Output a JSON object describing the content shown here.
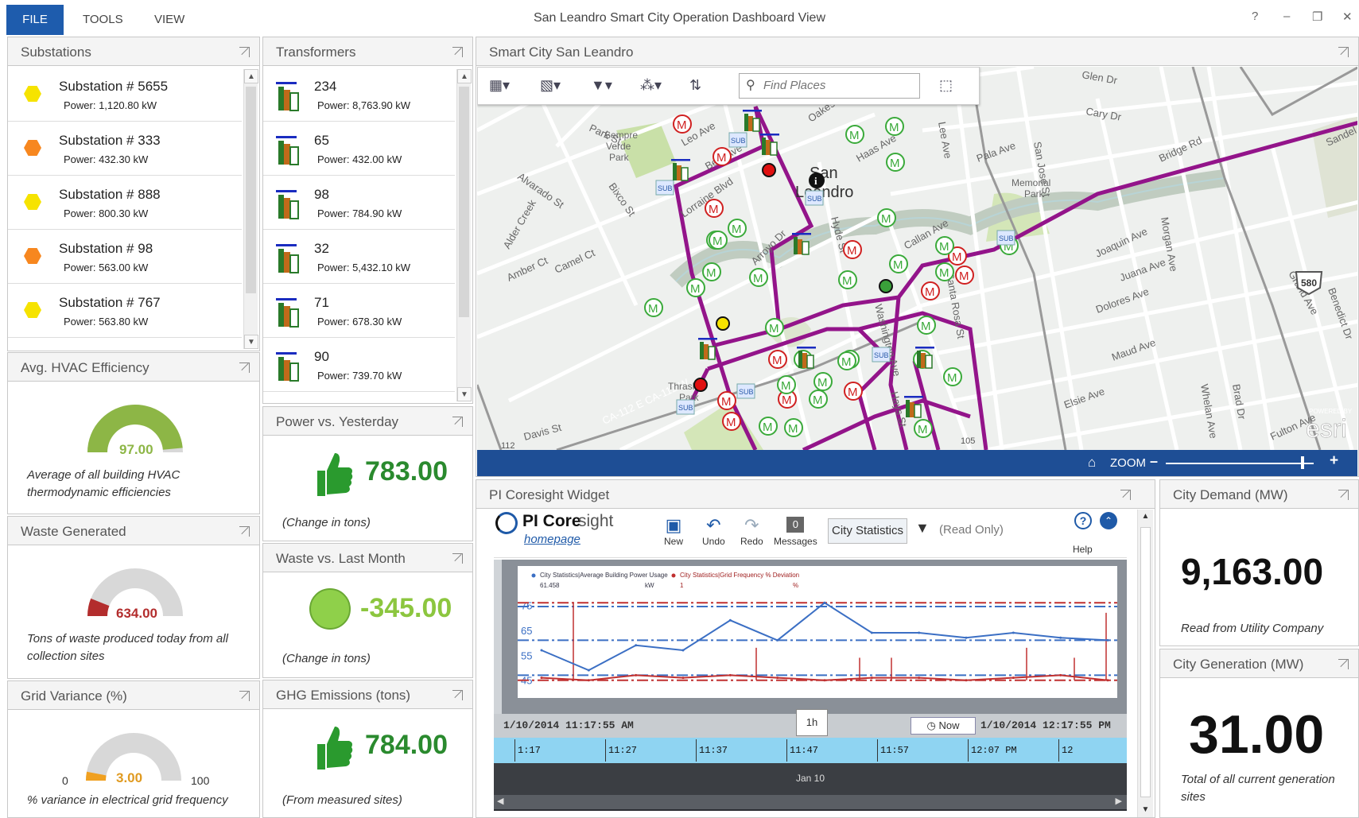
{
  "menu": {
    "file": "FILE",
    "tools": "TOOLS",
    "view": "VIEW"
  },
  "window": {
    "title": "San Leandro Smart City Operation Dashboard View",
    "help": "?",
    "minimize": "–",
    "restore": "❐",
    "close": "✕"
  },
  "substations": {
    "title": "Substations",
    "items": [
      {
        "name": "Substation # 5655",
        "power": "Power: 1,120.80 kW",
        "color": "#f6e300"
      },
      {
        "name": "Substation # 333",
        "power": "Power: 432.30 kW",
        "color": "#f7871f"
      },
      {
        "name": "Substation # 888",
        "power": "Power: 800.30 kW",
        "color": "#f6e300"
      },
      {
        "name": "Substation # 98",
        "power": "Power: 563.00 kW",
        "color": "#f7871f"
      },
      {
        "name": "Substation # 767",
        "power": "Power: 563.80 kW",
        "color": "#f6e300"
      }
    ]
  },
  "transformers": {
    "title": "Transformers",
    "items": [
      {
        "name": "234",
        "power": "Power: 8,763.90 kW"
      },
      {
        "name": "65",
        "power": "Power: 432.00 kW"
      },
      {
        "name": "98",
        "power": "Power: 784.90 kW"
      },
      {
        "name": "32",
        "power": "Power: 5,432.10 kW"
      },
      {
        "name": "71",
        "power": "Power: 678.30 kW"
      },
      {
        "name": "90",
        "power": "Power: 739.70 kW"
      }
    ]
  },
  "hvac": {
    "title": "Avg. HVAC Efficiency",
    "value": "97.00",
    "fraction": 0.97,
    "caption1": "Average of all building HVAC",
    "caption2": "thermodynamic efficiencies",
    "color": "#8db646"
  },
  "waste": {
    "title": "Waste Generated",
    "value": "634.00",
    "fraction": 0.12,
    "caption1": "Tons of waste produced today from all",
    "caption2": "collection sites",
    "color": "#b32d2d"
  },
  "grid": {
    "title": "Grid Variance (%)",
    "value": "3.00",
    "fraction": 0.03,
    "min": "0",
    "max": "100",
    "caption": "% variance in electrical grid frequency",
    "color": "#f0a020"
  },
  "power": {
    "title": "Power vs. Yesterday",
    "value": "783.00",
    "caption": "(Change in tons)"
  },
  "wasteMonth": {
    "title": "Waste vs. Last Month",
    "value": "-345.00",
    "caption": "(Change in tons)"
  },
  "ghg": {
    "title": "GHG Emissions (tons)",
    "value": "784.00",
    "caption": "(From measured sites)"
  },
  "map": {
    "title": "Smart City San Leandro",
    "find_placeholder": "Find Places",
    "zoom_label": "ZOOM",
    "labels": {
      "parkst": "Park St",
      "sempre": "Sempre",
      "verde": "Verde",
      "parkA": "Park",
      "leo": "Leo Ave",
      "best": "Best Ave",
      "oakes": "Oakes Blvd",
      "san": "San",
      "leandro": "Leandro",
      "alvarado": "Alvarado St",
      "bixco": "Bixco St",
      "alder": "Alder Creek",
      "amber": "Amber Ct",
      "camel": "Camel Ct",
      "lorraine": "Lorraine Blvd",
      "arroyo": "Arroyo Dr",
      "haas": "Haas Ave",
      "callan": "Callan Ave",
      "pala": "Pala Ave",
      "memorial": "Memorial",
      "parkB": "Park",
      "cary": "Cary Dr",
      "glen": "Glen Dr",
      "bridge": "Bridge Rd",
      "joaquin": "Joaquin Ave",
      "juana": "Juana Ave",
      "dolores": "Dolores Ave",
      "maud": "Maud Ave",
      "elsie": "Elsie Ave",
      "fulton": "Fulton Ave",
      "davis": "Davis St",
      "ca112": "CA-112 E CA-112 W",
      "thrasher": "Thrasher",
      "parkC": "Park",
      "grand": "Grand Ave",
      "sanjose": "San Jose St",
      "morgan": "Morgan Ave",
      "benedict": "Benedict Dr",
      "sandel": "Sandel",
      "hyde": "Hyde St",
      "washington": "Washington Ave",
      "hays": "Hays St",
      "leeave": "Lee Ave",
      "santarosa": "Santa Rosa St",
      "whelan": "Whelan Ave",
      "bradr": "Brad Dr",
      "fiveeighty": "580",
      "poweredby": "POWERED BY",
      "esri": "esri",
      "e112": "112",
      "e105": "105",
      "subtxt": "SUB",
      "metertxt": "M"
    }
  },
  "pi": {
    "title": "PI Coresight Widget",
    "brand1": "PI Core",
    "brand2": "sight",
    "home": "homepage",
    "btn_new": "New",
    "btn_undo": "Undo",
    "btn_redo": "Redo",
    "btn_messages": "Messages",
    "messages_count": "0",
    "display": "City Statistics",
    "readonly": "(Read Only)",
    "help": "Help",
    "start_time": "1/10/2014 11:17:55 AM",
    "end_time": "1/10/2014 12:17:55 PM",
    "duration": "1h",
    "now": "Now",
    "date_label": "Jan 10",
    "ticks": [
      "1:17",
      "11:27",
      "11:37",
      "11:47",
      "11:57",
      "12:07 PM",
      "12"
    ]
  },
  "chart_data": {
    "type": "line",
    "title": "",
    "x": [
      "11:17",
      "11:22",
      "11:27",
      "11:32",
      "11:37",
      "11:42",
      "11:47",
      "11:52",
      "11:57",
      "12:02",
      "12:07",
      "12:12",
      "12:17"
    ],
    "ylim": [
      43,
      78
    ],
    "yticks": [
      "75",
      "65",
      "55",
      "45"
    ],
    "series": [
      {
        "name": "City Statistics|Average Building Power Usage",
        "value": "61.458",
        "unit": "kW",
        "color": "#3b6fc4",
        "values": [
          57,
          49,
          59,
          57,
          69,
          61,
          76,
          64,
          64,
          62,
          64,
          62,
          61
        ]
      },
      {
        "name": "City Statistics|Grid Frequency % Deviation",
        "value": "1",
        "unit": "%",
        "color": "#c03030",
        "values": [
          46,
          45,
          47,
          46,
          47,
          46,
          45,
          46,
          46,
          45,
          46,
          47,
          45
        ]
      }
    ]
  },
  "demand": {
    "title": "City Demand (MW)",
    "value": "9,163.00",
    "caption": "Read from Utility Company"
  },
  "generation": {
    "title": "City Generation (MW)",
    "value": "31.00",
    "caption1": "Total of all current generation",
    "caption2": "sites"
  }
}
